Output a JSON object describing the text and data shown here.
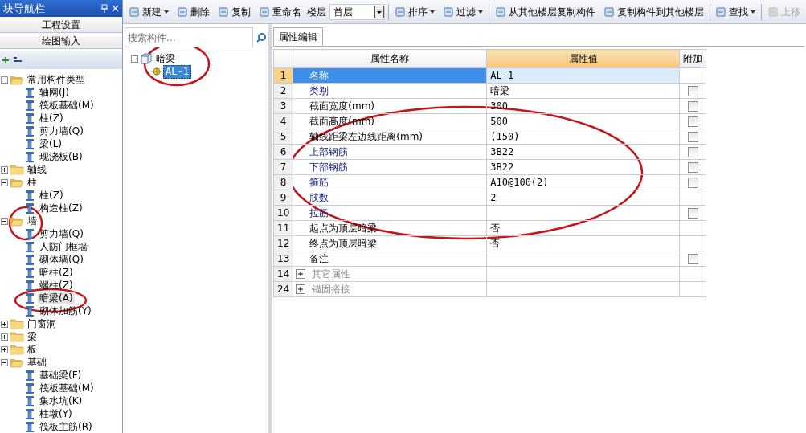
{
  "nav_panel": {
    "title": "块导航栏",
    "buttons": [
      "工程设置",
      "绘图输入"
    ],
    "tree": [
      {
        "label": "常用构件类型",
        "kind": "folder",
        "expanded": true,
        "selected": false,
        "children": [
          {
            "label": "轴网(J)",
            "kind": "leaf",
            "selected": false
          },
          {
            "label": "筏板基础(M)",
            "kind": "leaf",
            "selected": false
          },
          {
            "label": "柱(Z)",
            "kind": "leaf",
            "selected": false
          },
          {
            "label": "剪力墙(Q)",
            "kind": "leaf",
            "selected": false
          },
          {
            "label": "梁(L)",
            "kind": "leaf",
            "selected": false
          },
          {
            "label": "现浇板(B)",
            "kind": "leaf",
            "selected": false
          }
        ]
      },
      {
        "label": "轴线",
        "kind": "folder",
        "expanded": false,
        "selected": false
      },
      {
        "label": "柱",
        "kind": "folder",
        "expanded": true,
        "selected": false,
        "children": [
          {
            "label": "柱(Z)",
            "kind": "leaf",
            "selected": false
          },
          {
            "label": "构造柱(Z)",
            "kind": "leaf",
            "selected": false
          }
        ]
      },
      {
        "label": "墙",
        "kind": "folder",
        "expanded": true,
        "selected": false,
        "children": [
          {
            "label": "剪力墙(Q)",
            "kind": "leaf",
            "selected": false
          },
          {
            "label": "人防门框墙",
            "kind": "leaf",
            "selected": false
          },
          {
            "label": "砌体墙(Q)",
            "kind": "leaf",
            "selected": false
          },
          {
            "label": "暗柱(Z)",
            "kind": "leaf",
            "selected": false
          },
          {
            "label": "端柱(Z)",
            "kind": "leaf",
            "selected": false
          },
          {
            "label": "暗梁(A)",
            "kind": "leaf",
            "selected": true
          },
          {
            "label": "砌体加筋(Y)",
            "kind": "leaf",
            "selected": false
          }
        ]
      },
      {
        "label": "门窗洞",
        "kind": "folder",
        "expanded": false,
        "selected": false
      },
      {
        "label": "梁",
        "kind": "folder",
        "expanded": false,
        "selected": false
      },
      {
        "label": "板",
        "kind": "folder",
        "expanded": false,
        "selected": false
      },
      {
        "label": "基础",
        "kind": "folder",
        "expanded": true,
        "selected": false,
        "children": [
          {
            "label": "基础梁(F)",
            "kind": "leaf",
            "selected": false
          },
          {
            "label": "筏板基础(M)",
            "kind": "leaf",
            "selected": false
          },
          {
            "label": "集水坑(K)",
            "kind": "leaf",
            "selected": false
          },
          {
            "label": "柱墩(Y)",
            "kind": "leaf",
            "selected": false
          },
          {
            "label": "筏板主筋(R)",
            "kind": "leaf",
            "selected": false
          }
        ]
      }
    ]
  },
  "toolbar": [
    {
      "kind": "button",
      "label": "新建",
      "dropdown": true,
      "disabled": false
    },
    {
      "kind": "button",
      "label": "删除",
      "dropdown": false,
      "disabled": false
    },
    {
      "kind": "button",
      "label": "复制",
      "dropdown": false,
      "disabled": false
    },
    {
      "kind": "button",
      "label": "重命名",
      "dropdown": false,
      "disabled": false
    },
    {
      "kind": "floor",
      "label": "楼层",
      "value": "首层"
    },
    {
      "kind": "button",
      "label": "排序",
      "dropdown": true,
      "disabled": false
    },
    {
      "kind": "button",
      "label": "过滤",
      "dropdown": true,
      "disabled": false
    },
    {
      "kind": "button",
      "label": "从其他楼层复制构件",
      "dropdown": false,
      "disabled": false
    },
    {
      "kind": "button",
      "label": "复制构件到其他楼层",
      "dropdown": false,
      "disabled": false
    },
    {
      "kind": "button",
      "label": "查找",
      "dropdown": true,
      "disabled": false
    },
    {
      "kind": "button",
      "label": "上移",
      "dropdown": false,
      "disabled": true
    }
  ],
  "component_list": {
    "search": {
      "placeholder": "搜索构件..."
    },
    "tree": [
      {
        "label": "暗梁",
        "expanded": true,
        "selected": false,
        "children": [
          {
            "label": "AL-1",
            "selected": true
          }
        ]
      }
    ]
  },
  "property_editor": {
    "tab": "属性编辑",
    "columns": [
      "属性名称",
      "属性值",
      "附加"
    ],
    "rows": [
      {
        "num": "1",
        "name": "名称",
        "value": "AL-1",
        "kind": "field",
        "public": true,
        "selected": true
      },
      {
        "num": "2",
        "name": "类别",
        "value": "暗梁",
        "kind": "field",
        "public": true,
        "selected": false,
        "extra": {
          "checked": false
        }
      },
      {
        "num": "3",
        "name": "截面宽度(mm)",
        "value": "300",
        "kind": "field",
        "public": false,
        "selected": false,
        "extra": {
          "checked": false
        }
      },
      {
        "num": "4",
        "name": "截面高度(mm)",
        "value": "500",
        "kind": "field",
        "public": false,
        "selected": false,
        "extra": {
          "checked": false
        }
      },
      {
        "num": "5",
        "name": "轴线距梁左边线距离(mm)",
        "value": "(150)",
        "kind": "field",
        "public": false,
        "selected": false,
        "extra": {
          "checked": false
        }
      },
      {
        "num": "6",
        "name": "上部钢筋",
        "value": "3B22",
        "kind": "field",
        "public": true,
        "selected": false,
        "extra": {
          "checked": false
        }
      },
      {
        "num": "7",
        "name": "下部钢筋",
        "value": "3B22",
        "kind": "field",
        "public": true,
        "selected": false,
        "extra": {
          "checked": false
        }
      },
      {
        "num": "8",
        "name": "箍筋",
        "value": "A10@100(2)",
        "kind": "field",
        "public": true,
        "selected": false,
        "extra": {
          "checked": false
        }
      },
      {
        "num": "9",
        "name": "肢数",
        "value": "2",
        "kind": "field",
        "public": true,
        "selected": false
      },
      {
        "num": "10",
        "name": "拉筋",
        "kind": "field",
        "public": true,
        "selected": false,
        "extra": {
          "checked": false
        }
      },
      {
        "num": "11",
        "name": "起点为顶层暗梁",
        "value": "否",
        "kind": "field",
        "public": false,
        "selected": false
      },
      {
        "num": "12",
        "name": "终点为顶层暗梁",
        "value": "否",
        "kind": "field",
        "public": false,
        "selected": false
      },
      {
        "num": "13",
        "name": "备注",
        "kind": "field",
        "public": false,
        "selected": false,
        "extra": {
          "checked": false
        }
      },
      {
        "num": "14",
        "name": "其它属性",
        "kind": "group",
        "expanded": false,
        "selected": false
      },
      {
        "num": "24",
        "name": "锚固搭接",
        "kind": "group",
        "expanded": false,
        "selected": false
      }
    ]
  },
  "annotations": [
    {
      "kind": "ellipse",
      "color": "#c8141b"
    },
    {
      "kind": "ellipse",
      "color": "#c8141b"
    },
    {
      "kind": "ellipse",
      "color": "#c8141b"
    },
    {
      "kind": "ellipse",
      "color": "#c8141b"
    }
  ]
}
